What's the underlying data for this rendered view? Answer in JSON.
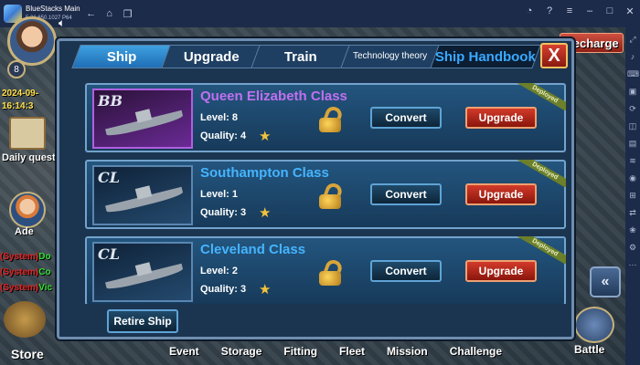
{
  "window": {
    "title": "BlueStacks Main",
    "subtitle": "5.21.650.1027  P64"
  },
  "hud": {
    "player_level": "8",
    "date_line1": "2024-09-",
    "date_line2": "16:14:3",
    "daily_quest": "Daily quest",
    "adviser": "Ade",
    "recharge": "Recharge",
    "store": "Store",
    "battle": "Battle",
    "chat": [
      {
        "prefix": "(System)",
        "suffix": "Do"
      },
      {
        "prefix": "(System)",
        "suffix": "Co"
      },
      {
        "prefix": "(System)",
        "suffix": "Vic"
      }
    ],
    "bottom_nav": [
      "Event",
      "Storage",
      "Fitting",
      "Fleet",
      "Mission",
      "Challenge"
    ]
  },
  "dialog": {
    "tabs": [
      "Ship",
      "Upgrade",
      "Train",
      "Technology theory",
      "Ship Handbook"
    ],
    "active_tab": "Ship",
    "close_label": "X",
    "retire_label": "Retire Ship",
    "ships": [
      {
        "class_code": "BB",
        "name": "Queen Elizabeth Class",
        "level": "Level: 8",
        "quality": "Quality: 4",
        "status": "Deployed",
        "convert": "Convert",
        "upgrade": "Upgrade"
      },
      {
        "class_code": "CL",
        "name": "Southampton Class",
        "level": "Level: 1",
        "quality": "Quality: 3",
        "status": "Deployed",
        "convert": "Convert",
        "upgrade": "Upgrade"
      },
      {
        "class_code": "CL",
        "name": "Cleveland Class",
        "level": "Level: 2",
        "quality": "Quality: 3",
        "status": "Deployed",
        "convert": "Convert",
        "upgrade": "Upgrade"
      }
    ]
  },
  "colors": {
    "accent_blue": "#45b4ff",
    "bb_purple": "#c070f0",
    "upgrade_red": "#d23a2a"
  }
}
